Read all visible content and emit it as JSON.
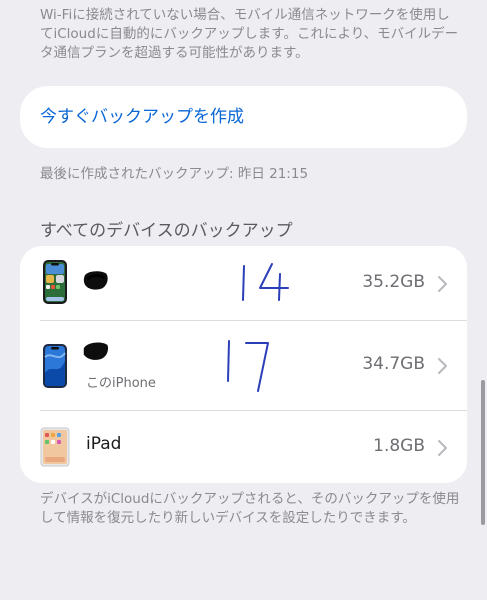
{
  "top_note": "Wi-Fiに接続されていない場合、モバイル通信ネットワークを使用してiCloudに自動的にバックアップします。これにより、モバイルデータ通信プランを超過する可能性があります。",
  "backup_now_label": "今すぐバックアップを作成",
  "last_backup": "最後に作成されたバックアップ: 昨日 21:15",
  "section_header": "すべてのデバイスのバックアップ",
  "devices": [
    {
      "name": "",
      "sub": "",
      "size": "35.2GB",
      "handwritten": "14",
      "icon": "iphone-14-icon"
    },
    {
      "name": "",
      "sub": "このiPhone",
      "size": "34.7GB",
      "handwritten": "17",
      "icon": "iphone-17-icon"
    },
    {
      "name": "iPad",
      "sub": "",
      "size": "1.8GB",
      "handwritten": "",
      "icon": "ipad-icon"
    }
  ],
  "bottom_note": "デバイスがiCloudにバックアップされると、そのバックアップを使用して情報を復元したり新しいデバイスを設定したりできます。",
  "colors": {
    "background": "#eeeef2",
    "link": "#0a67d6",
    "secondary_text": "#8a8a8f",
    "pen_ink": "#2a3fb8"
  }
}
